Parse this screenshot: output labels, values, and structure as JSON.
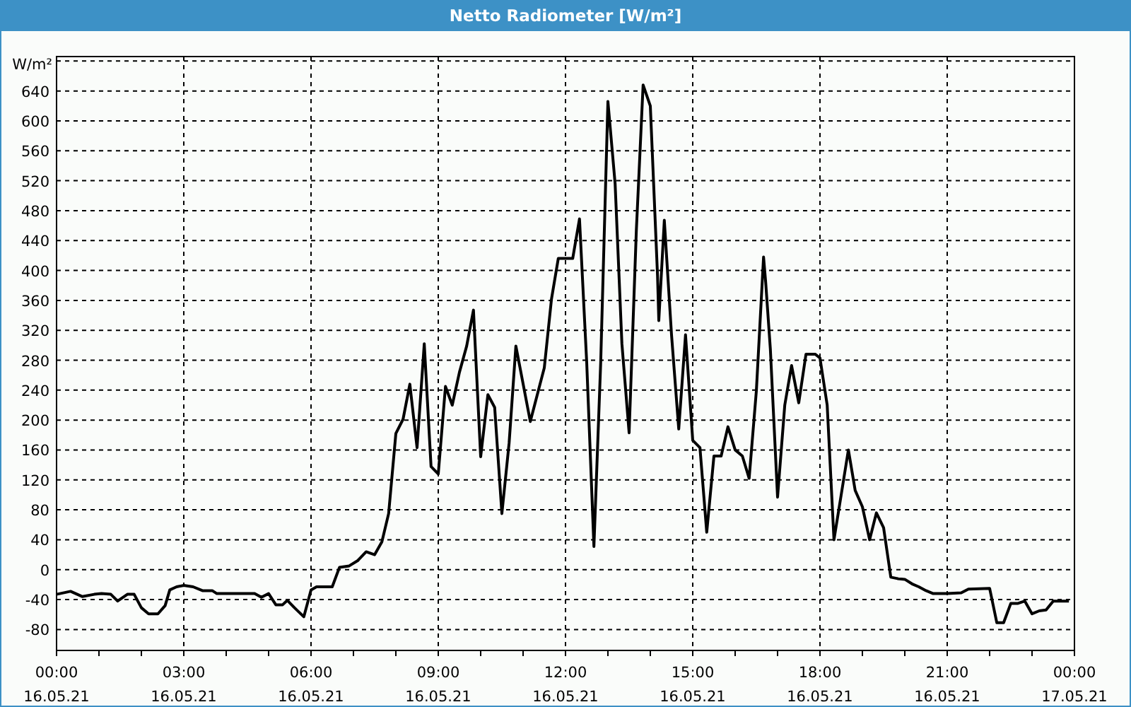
{
  "window": {
    "title": "Netto Radiometer [W/m²]"
  },
  "x_axis_dates": [
    "16.05.21",
    "16.05.21",
    "16.05.21",
    "16.05.21",
    "16.05.21",
    "16.05.21",
    "16.05.21",
    "16.05.21",
    "17.05.21"
  ],
  "chart_data": {
    "type": "line",
    "grid": true,
    "ylabel": "W/m²",
    "xlim": [
      0,
      24
    ],
    "ylim": [
      -108,
      686
    ],
    "xticks": [
      {
        "value": 0,
        "label": "00:00"
      },
      {
        "value": 3,
        "label": "03:00"
      },
      {
        "value": 6,
        "label": "06:00"
      },
      {
        "value": 9,
        "label": "09:00"
      },
      {
        "value": 12,
        "label": "12:00"
      },
      {
        "value": 15,
        "label": "15:00"
      },
      {
        "value": 18,
        "label": "18:00"
      },
      {
        "value": 21,
        "label": "21:00"
      },
      {
        "value": 24,
        "label": "00:00"
      }
    ],
    "yticks": [
      -80,
      -40,
      0,
      40,
      80,
      120,
      160,
      200,
      240,
      280,
      320,
      360,
      400,
      440,
      480,
      520,
      560,
      600,
      640
    ],
    "x": [
      0,
      0.33,
      0.61,
      0.89,
      1.06,
      1.28,
      1.44,
      1.67,
      1.83,
      2.0,
      2.17,
      2.39,
      2.56,
      2.67,
      2.83,
      3.0,
      3.22,
      3.44,
      3.67,
      3.78,
      4.67,
      4.83,
      5.0,
      5.17,
      5.33,
      5.44,
      5.61,
      5.83,
      6.0,
      6.13,
      6.5,
      6.67,
      6.9,
      7.1,
      7.3,
      7.5,
      7.67,
      7.83,
      8.0,
      8.17,
      8.33,
      8.5,
      8.67,
      8.83,
      9.0,
      9.17,
      9.33,
      9.5,
      9.67,
      9.83,
      10.0,
      10.17,
      10.33,
      10.5,
      10.67,
      10.83,
      11.17,
      11.5,
      11.67,
      11.83,
      12.17,
      12.33,
      12.5,
      12.67,
      12.83,
      13.0,
      13.17,
      13.33,
      13.5,
      13.67,
      13.83,
      14.0,
      14.17,
      14.2,
      14.33,
      14.5,
      14.67,
      14.83,
      15.0,
      15.17,
      15.33,
      15.5,
      15.67,
      15.83,
      16.0,
      16.17,
      16.33,
      16.5,
      16.67,
      16.72,
      16.83,
      17.0,
      17.17,
      17.33,
      17.5,
      17.67,
      17.89,
      18.0,
      18.17,
      18.33,
      18.5,
      18.67,
      18.83,
      19.0,
      19.17,
      19.33,
      19.5,
      19.67,
      19.83,
      20.0,
      20.17,
      20.33,
      20.5,
      20.67,
      21.0,
      21.33,
      21.5,
      22.0,
      22.17,
      22.33,
      22.5,
      22.67,
      22.83,
      23.0,
      23.17,
      23.33,
      23.5,
      23.87
    ],
    "values": [
      -33,
      -29,
      -36,
      -33,
      -32,
      -33,
      -42,
      -33,
      -33,
      -51,
      -59,
      -59,
      -48,
      -27,
      -23,
      -21,
      -23,
      -28,
      -28,
      -32,
      -32,
      -37,
      -32,
      -47,
      -47,
      -41,
      -51,
      -63,
      -27,
      -23,
      -23,
      3,
      5,
      12,
      24,
      20,
      37,
      75,
      182,
      201,
      248,
      163,
      302,
      138,
      128,
      245,
      220,
      264,
      299,
      347,
      151,
      234,
      217,
      75,
      169,
      299,
      198,
      270,
      362,
      416,
      416,
      469,
      277,
      31,
      277,
      626,
      516,
      302,
      183,
      453,
      648,
      620,
      393,
      333,
      467,
      314,
      188,
      314,
      173,
      163,
      50,
      152,
      152,
      191,
      160,
      152,
      122,
      239,
      418,
      384,
      295,
      97,
      220,
      273,
      223,
      288,
      288,
      283,
      220,
      40,
      100,
      160,
      106,
      84,
      40,
      76,
      56,
      -10,
      -12,
      -13,
      -19,
      -23,
      -28,
      -32,
      -32,
      -31,
      -26,
      -25,
      -71,
      -71,
      -45,
      -45,
      -42,
      -59,
      -55,
      -54,
      -42,
      -42
    ]
  }
}
